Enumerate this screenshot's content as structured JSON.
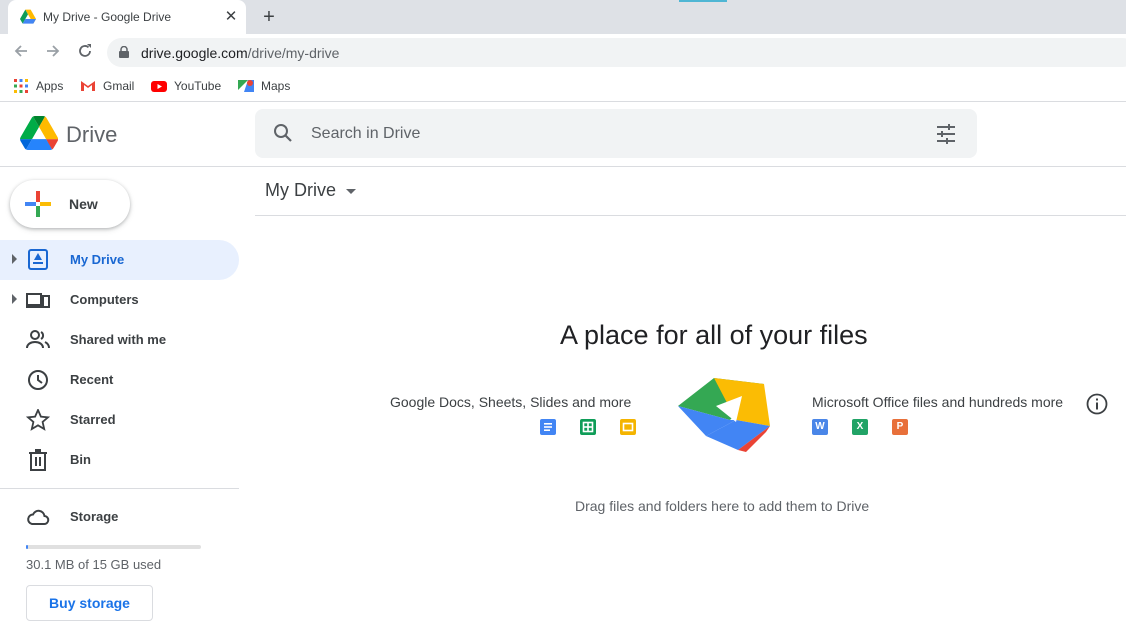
{
  "browser": {
    "tab_title": "My Drive - Google Drive",
    "tab_close": "✕",
    "new_tab": "+",
    "url_host": "drive.google.com",
    "url_path": "/drive/my-drive",
    "bookmarks": [
      {
        "label": "Apps",
        "icon": "apps-grid-icon"
      },
      {
        "label": "Gmail",
        "icon": "gmail-icon"
      },
      {
        "label": "YouTube",
        "icon": "youtube-icon"
      },
      {
        "label": "Maps",
        "icon": "maps-icon"
      }
    ]
  },
  "header": {
    "app_name": "Drive",
    "search_placeholder": "Search in Drive"
  },
  "sidebar": {
    "new_label": "New",
    "items": [
      {
        "label": "My Drive",
        "icon": "my-drive-icon",
        "active": true
      },
      {
        "label": "Computers",
        "icon": "computers-icon"
      },
      {
        "label": "Shared with me",
        "icon": "shared-people-icon"
      },
      {
        "label": "Recent",
        "icon": "clock-icon"
      },
      {
        "label": "Starred",
        "icon": "star-icon"
      },
      {
        "label": "Bin",
        "icon": "trash-icon"
      },
      {
        "label": "Storage",
        "icon": "cloud-icon"
      }
    ],
    "storage_used_text": "30.1 MB of 15 GB used",
    "storage_fraction": 0.002,
    "buy_storage": "Buy storage"
  },
  "main": {
    "title": "My Drive",
    "hero_title": "A place for all of your files",
    "left_caption": "Google Docs, Sheets, Slides and more",
    "right_caption": "Microsoft Office files and hundreds more",
    "office_icons": [
      "W",
      "X",
      "P"
    ],
    "drag_text": "Drag files and folders here to add them to Drive"
  },
  "colors": {
    "accent_blue": "#1a73e8",
    "active_bg": "#e8f0fe",
    "docs_blue": "#4285f4",
    "sheets_green": "#0f9d58",
    "slides_yellow": "#f4b400",
    "word_blue": "#4a86e8",
    "excel_green": "#21a366",
    "ppt_orange": "#e8703a"
  }
}
